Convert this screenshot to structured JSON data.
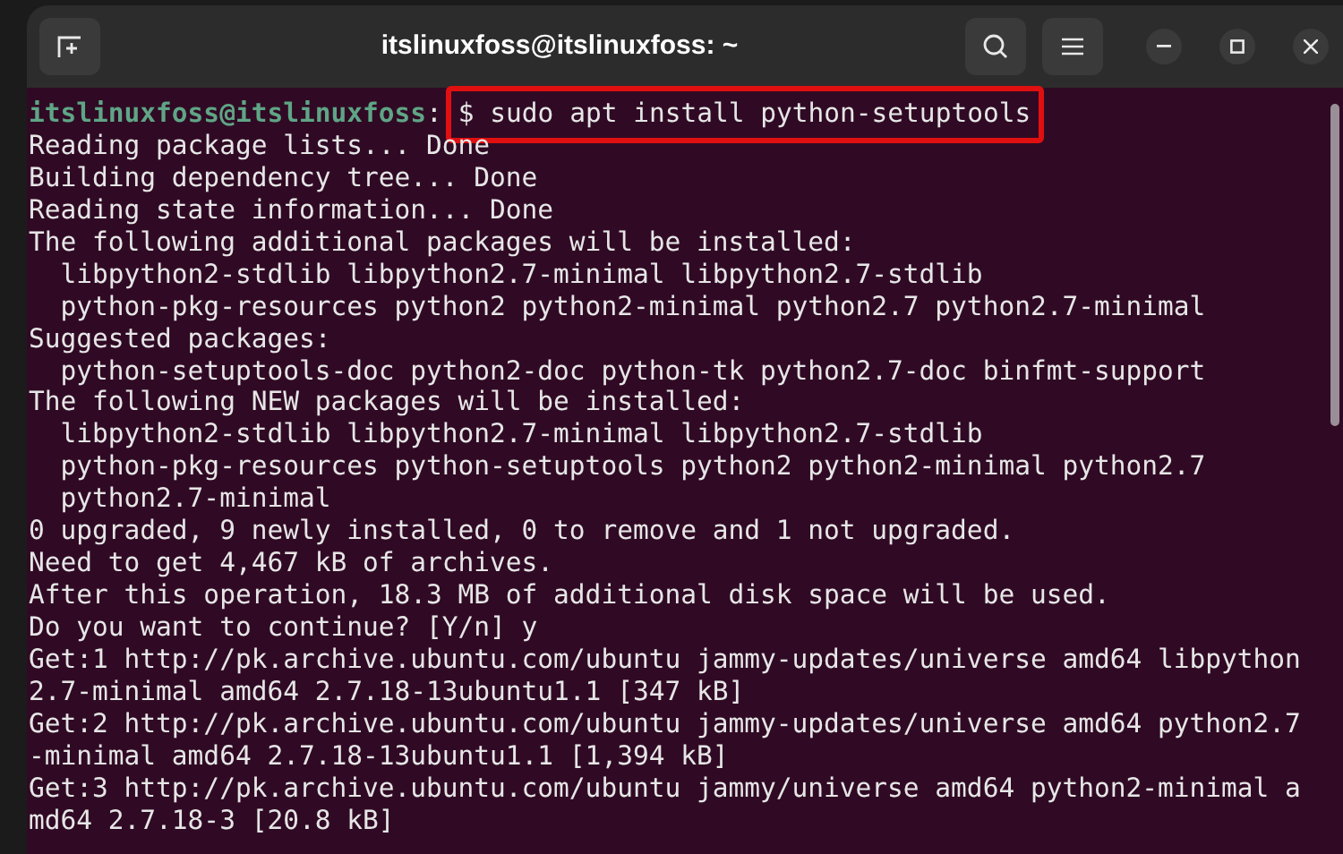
{
  "window": {
    "title": "itslinuxfoss@itslinuxfoss: ~"
  },
  "prompt": {
    "user_host": "itslinuxfoss@itslinuxfoss",
    "separator": ":",
    "command": "$ sudo apt install python-setuptools",
    "highlighted": true
  },
  "output": [
    "Reading package lists... Done",
    "Building dependency tree... Done",
    "Reading state information... Done",
    "The following additional packages will be installed:",
    "  libpython2-stdlib libpython2.7-minimal libpython2.7-stdlib",
    "  python-pkg-resources python2 python2-minimal python2.7 python2.7-minimal",
    "Suggested packages:",
    "  python-setuptools-doc python2-doc python-tk python2.7-doc binfmt-support",
    "The following NEW packages will be installed:",
    "  libpython2-stdlib libpython2.7-minimal libpython2.7-stdlib",
    "  python-pkg-resources python-setuptools python2 python2-minimal python2.7",
    "  python2.7-minimal",
    "0 upgraded, 9 newly installed, 0 to remove and 1 not upgraded.",
    "Need to get 4,467 kB of archives.",
    "After this operation, 18.3 MB of additional disk space will be used.",
    "Do you want to continue? [Y/n] y",
    "Get:1 http://pk.archive.ubuntu.com/ubuntu jammy-updates/universe amd64 libpython",
    "2.7-minimal amd64 2.7.18-13ubuntu1.1 [347 kB]",
    "Get:2 http://pk.archive.ubuntu.com/ubuntu jammy-updates/universe amd64 python2.7",
    "-minimal amd64 2.7.18-13ubuntu1.1 [1,394 kB]",
    "Get:3 http://pk.archive.ubuntu.com/ubuntu jammy/universe amd64 python2-minimal a",
    "md64 2.7.18-3 [20.8 kB]"
  ]
}
